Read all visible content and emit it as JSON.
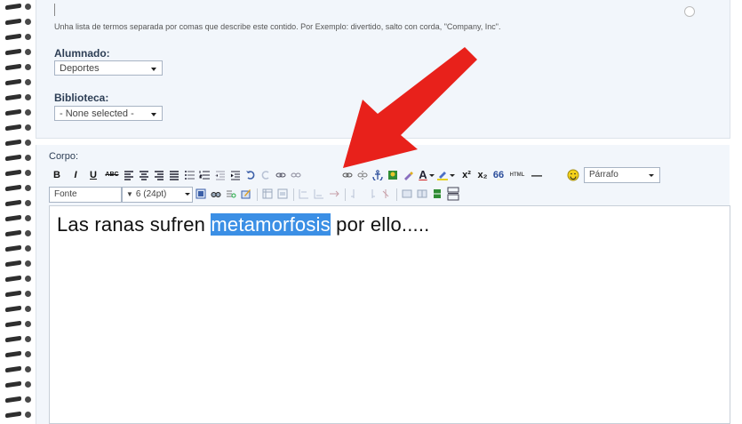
{
  "tags": {
    "help_text": "Unha lista de termos separada por comas que describe este contido. Por Exemplo: divertido, salto con corda, \"Company, Inc\"."
  },
  "alumnado": {
    "label": "Alumnado:",
    "selected": "Deportes"
  },
  "biblioteca": {
    "label": "Biblioteca:",
    "selected": "- None selected -"
  },
  "corpo": {
    "label": "Corpo:"
  },
  "toolbar1": {
    "bold": "B",
    "italic": "I",
    "underline": "U",
    "strike": "ABC",
    "superscript": "x²",
    "subscript": "x₂",
    "blockquote": "66",
    "html": "HTML",
    "hr": "—",
    "format_selected": "Párrafo",
    "icons": [
      "align-left-icon",
      "align-center-icon",
      "align-right-icon",
      "align-justify-icon",
      "bullet-list-icon",
      "numbered-list-icon",
      "outdent-icon",
      "indent-icon",
      "undo-icon",
      "redo-icon",
      "link-icon",
      "unlink-icon",
      "anchor-icon",
      "image-icon",
      "cleanup-icon",
      "font-color-icon",
      "highlight-icon",
      "smiley-icon"
    ]
  },
  "toolbar2": {
    "font_selected": "Fonte",
    "size_selected": "6 (24pt)",
    "icons": [
      "fullscreen-icon",
      "find-icon",
      "replace-icon",
      "edit-icon",
      "table-icon",
      "table-props-icon",
      "row-before-icon",
      "row-after-icon",
      "delete-row-icon",
      "col-before-icon",
      "col-after-icon",
      "delete-col-icon",
      "split-cells-icon",
      "merge-cells-icon",
      "page-break-icon"
    ]
  },
  "editor": {
    "before": "Las ranas sufren ",
    "selected": "metamorfosis",
    "after": " por ello....."
  },
  "colors": {
    "highlight": "#3b8fe5",
    "arrow": "#e8211b",
    "panel": "#f2f6fb",
    "label": "#2d3e55"
  }
}
